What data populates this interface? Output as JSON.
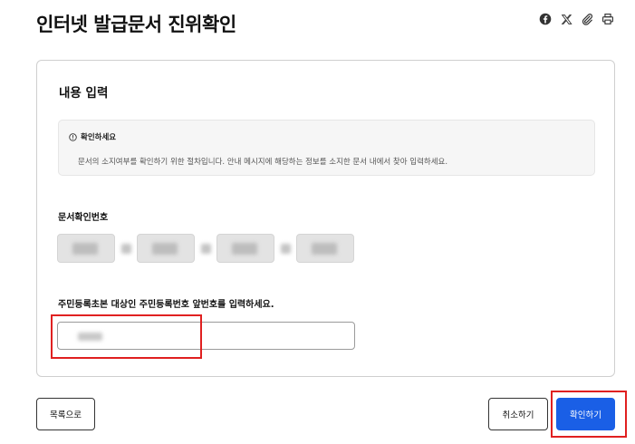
{
  "page": {
    "title": "인터넷 발급문서 진위확인"
  },
  "share": {
    "icons": [
      "facebook-icon",
      "x-icon",
      "attachment-icon",
      "print-icon"
    ]
  },
  "form": {
    "title": "내용 입력",
    "notice": {
      "title": "확인하세요",
      "text": "문서의 소지여부를 확인하기 위한 절차입니다. 안내 메시지에 해당하는 정보를 소지한 문서 내에서 찾아 입력하세요."
    },
    "document_number": {
      "label": "문서확인번호",
      "segments": 4
    },
    "resident_number": {
      "label": "주민등록초본 대상인 주민등록번호 앞번호를 입력하세요."
    }
  },
  "buttons": {
    "list": "목록으로",
    "cancel": "취소하기",
    "confirm": "확인하기"
  },
  "colors": {
    "primary": "#1a5fe6",
    "highlight": "#e02020"
  }
}
